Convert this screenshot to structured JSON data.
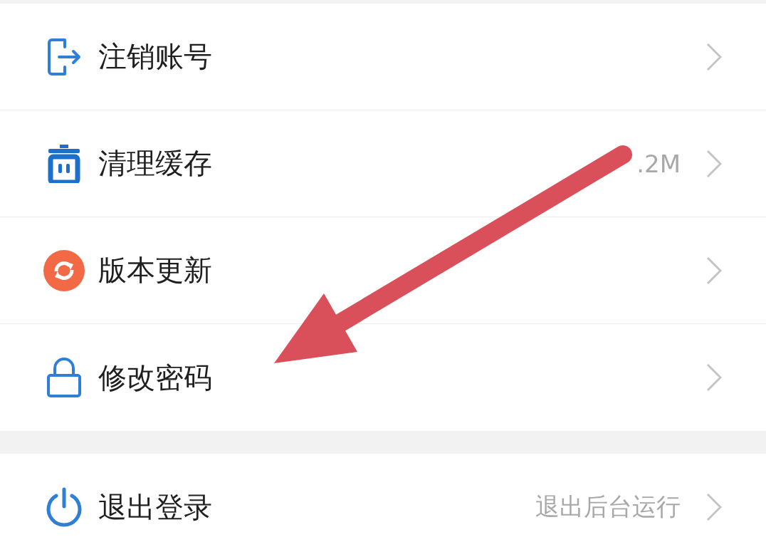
{
  "groups": [
    {
      "items": [
        {
          "kind": "exit",
          "label": "注销账号"
        },
        {
          "kind": "trash",
          "label": "清理缓存",
          "value": ".2M"
        },
        {
          "kind": "refresh",
          "label": "版本更新"
        },
        {
          "kind": "lock",
          "label": "修改密码"
        }
      ]
    },
    {
      "items": [
        {
          "kind": "power",
          "label": "退出登录",
          "value": "退出后台运行"
        }
      ]
    }
  ],
  "annotation": {
    "kind": "arrow"
  }
}
